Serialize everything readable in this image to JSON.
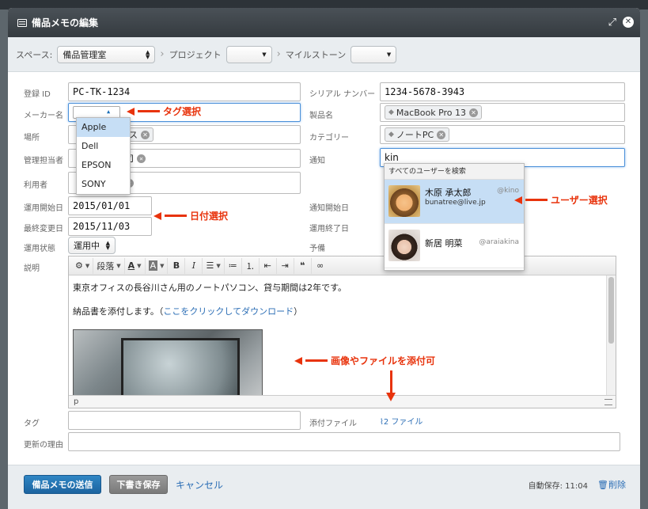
{
  "window": {
    "title": "備品メモの編集"
  },
  "space_bar": {
    "space_label": "スペース:",
    "space_value": "備品管理室",
    "project_label": "プロジェクト",
    "milestone_label": "マイルストーン"
  },
  "fields": {
    "reg_id": {
      "label": "登録 ID",
      "value": "PC-TK-1234"
    },
    "maker": {
      "label": "メーカー名"
    },
    "place": {
      "label": "場所",
      "tag": "ス"
    },
    "manager": {
      "label": "管理担当者"
    },
    "user": {
      "label": "利用者"
    },
    "start_date": {
      "label": "運用開始日",
      "value": "2015/01/01"
    },
    "last_change": {
      "label": "最終変更日",
      "value": "2015/11/03"
    },
    "status": {
      "label": "運用状態",
      "value": "運用中"
    },
    "description": {
      "label": "説明"
    },
    "tag": {
      "label": "タグ"
    },
    "reason": {
      "label": "更新の理由"
    },
    "serial": {
      "label": "シリアル ナンバー",
      "value": "1234-5678-3943"
    },
    "product": {
      "label": "製品名",
      "tag": "MacBook Pro 13"
    },
    "category": {
      "label": "カテゴリー",
      "tag": "ノートPC"
    },
    "notify": {
      "label": "通知",
      "value": "kin"
    },
    "notify_start": {
      "label": "通知開始日"
    },
    "notify_end": {
      "label": "運用終了日"
    },
    "reserve": {
      "label": "予備"
    },
    "attach": {
      "label": "添付ファイル",
      "value": "2 ファイル"
    }
  },
  "maker_options": [
    "Apple",
    "Dell",
    "EPSON",
    "SONY"
  ],
  "user_search": {
    "header": "すべてのユーザーを検索",
    "users": [
      {
        "name": "木原 承太郎",
        "handle": "@kino",
        "email": "bunatree@live.jp"
      },
      {
        "name": "新居 明菜",
        "handle": "@araiakina",
        "email": ""
      }
    ]
  },
  "editor": {
    "toolbar": {
      "paragraph": "段落",
      "bold": "B",
      "italic": "I",
      "quote": "❝"
    },
    "line1": "東京オフィスの長谷川さん用のノートパソコン、貸与期間は2年です。",
    "line2_prefix": "納品書を添付します。（",
    "line2_link": "ここをクリックしてダウンロード",
    "line2_suffix": "）",
    "status_path": "p"
  },
  "annotations": {
    "tag_select": "タグ選択",
    "date_select": "日付選択",
    "user_select": "ユーザー選択",
    "attach_note": "画像やファイルを添付可"
  },
  "footer": {
    "send": "備品メモの送信",
    "draft": "下書き保存",
    "cancel": "キャンセル",
    "autosave": "自動保存: 11:04",
    "delete": "削除"
  },
  "colors": {
    "accent": "#1c64a0",
    "annotation": "#e8330c",
    "highlight": "#c6def5"
  }
}
